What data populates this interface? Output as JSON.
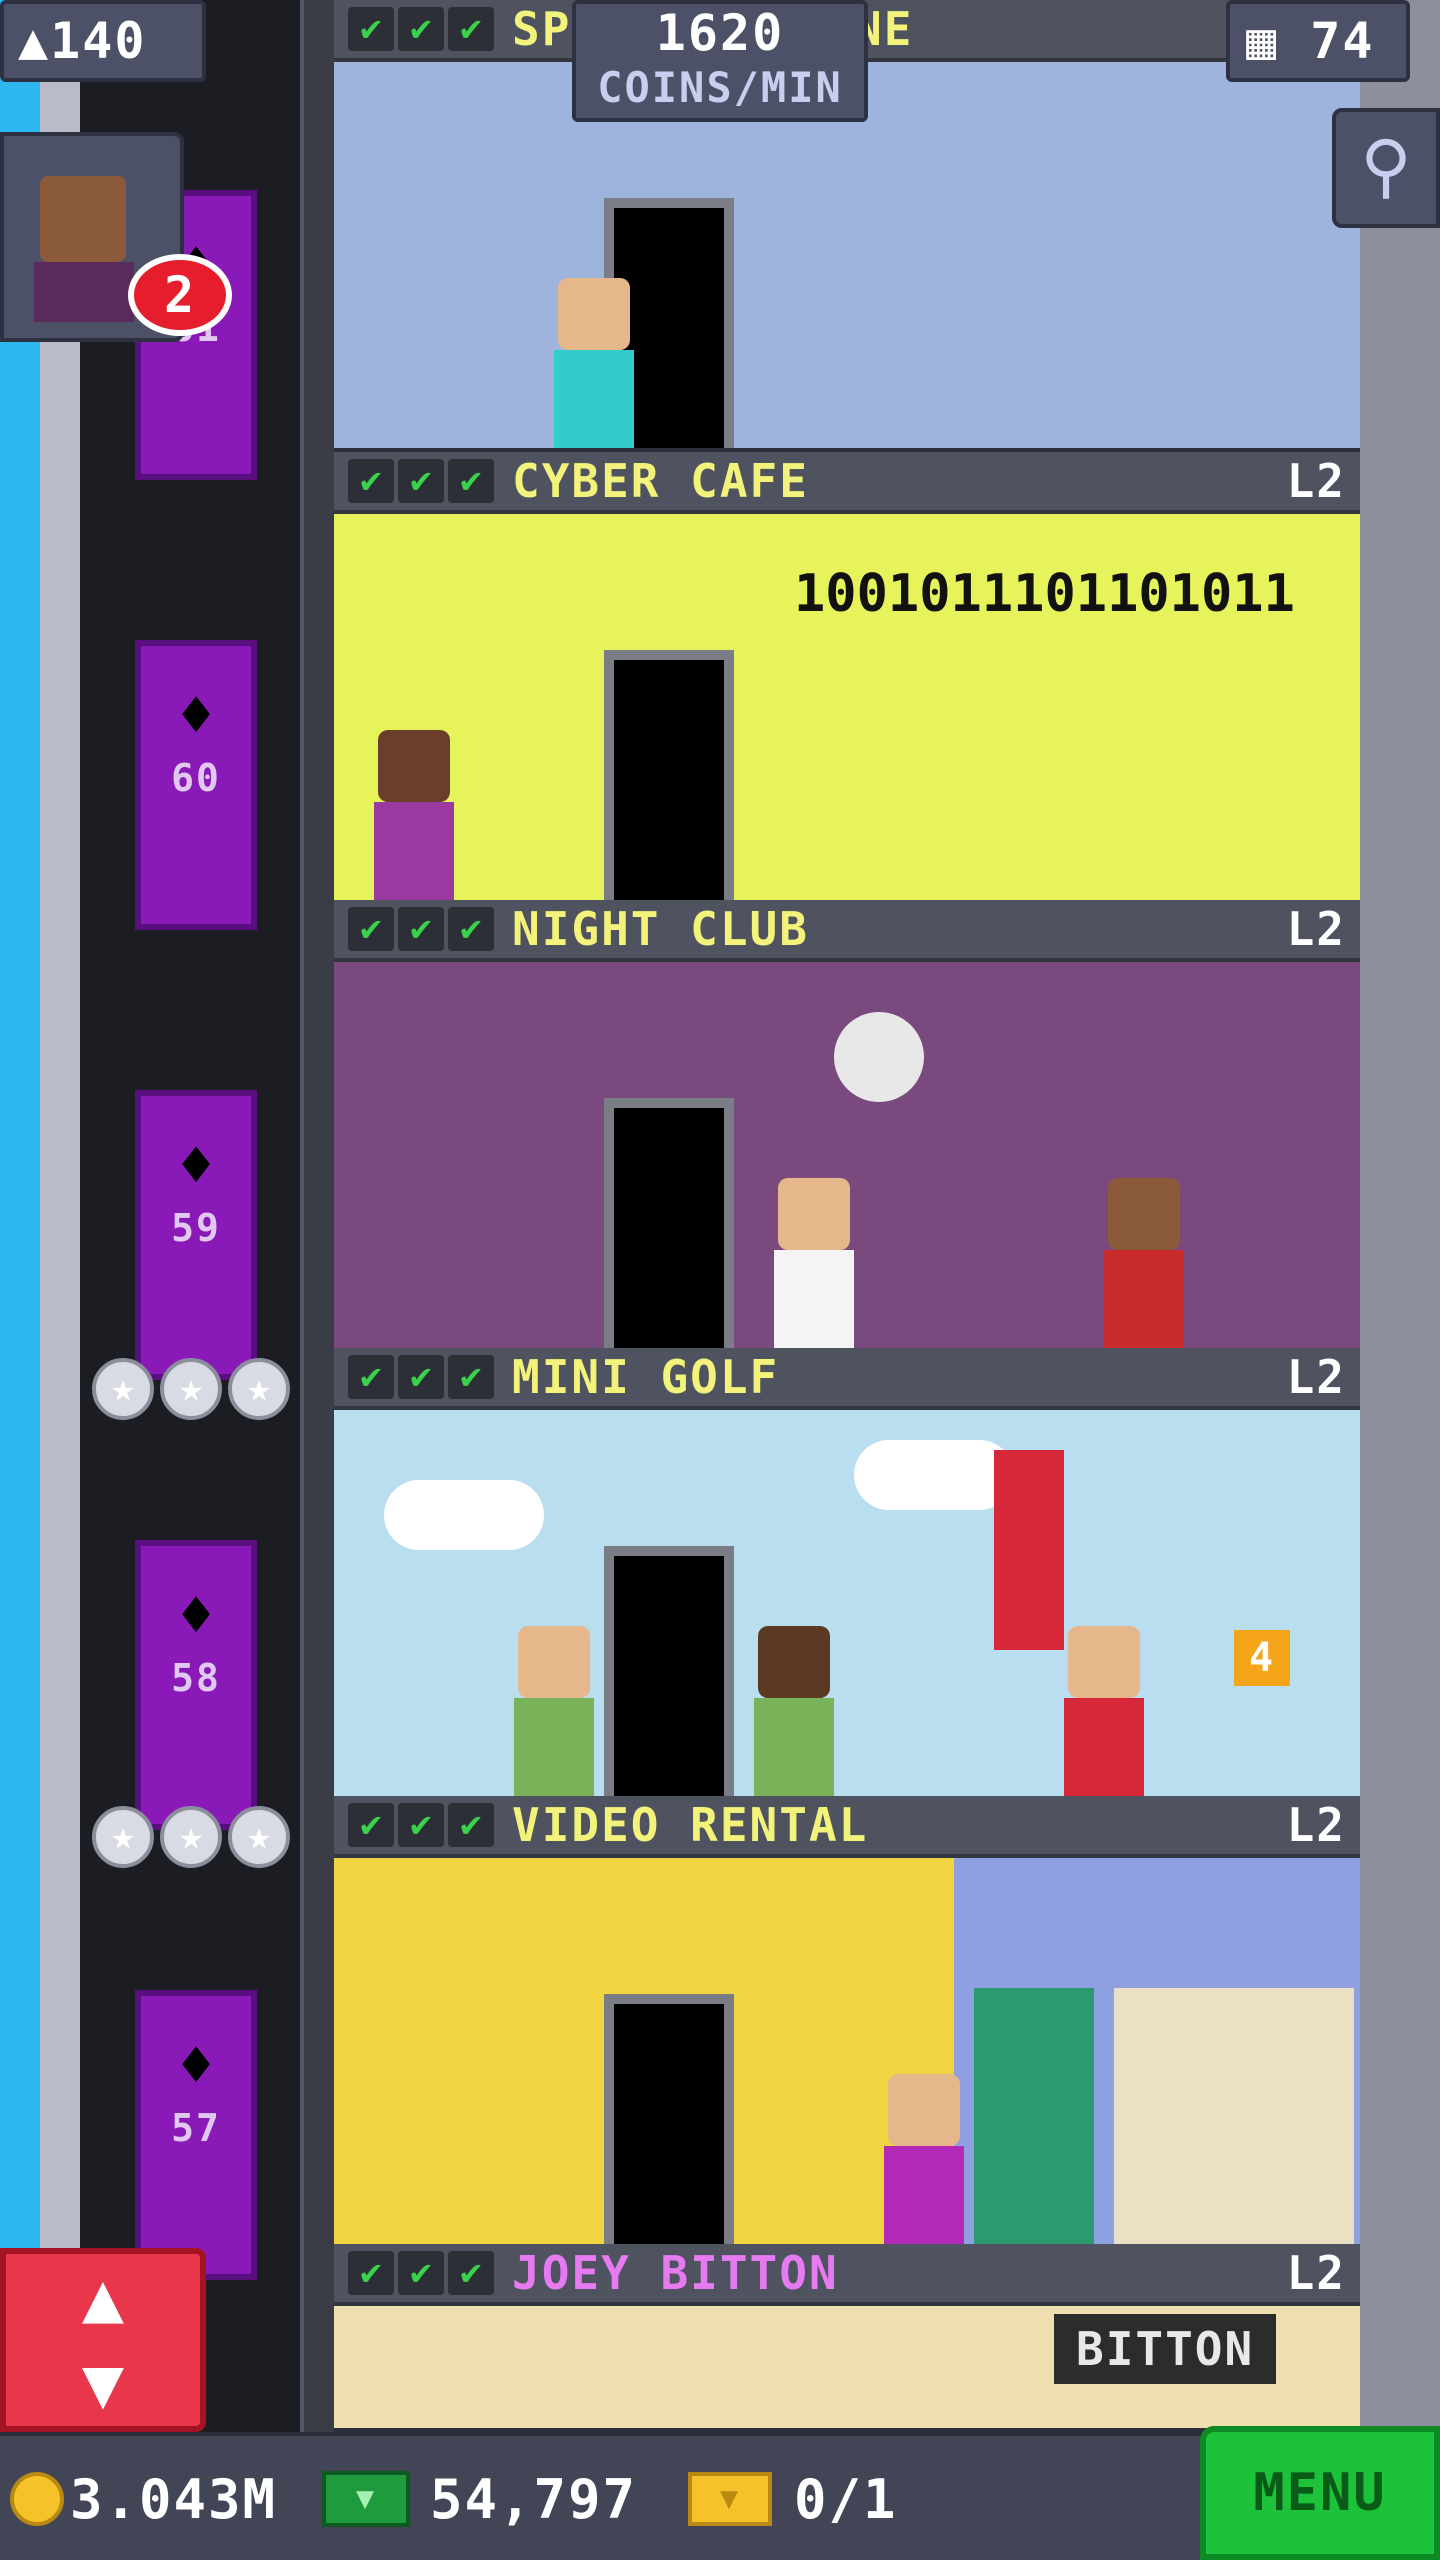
{
  "hud": {
    "population": "140",
    "coins_per_min_value": "1620",
    "coins_per_min_unit": "COINS/MIN",
    "floor_count": "74",
    "visitor_badge": "2"
  },
  "elevator": {
    "floor_labels": [
      "61",
      "60",
      "59",
      "58",
      "57"
    ]
  },
  "floors": [
    {
      "name": "SPA",
      "level": "",
      "partial_name": "SP",
      "partial_suffix": "NE",
      "room_color": "#9fb4dc"
    },
    {
      "name": "CYBER CAFE",
      "level": "L2",
      "room_text": "1001011101101011",
      "room_color": "#e6f35a"
    },
    {
      "name": "NIGHT CLUB",
      "level": "L2",
      "room_color": "#7a4a7e"
    },
    {
      "name": "MINI GOLF",
      "level": "L2",
      "room_color": "#b9def0",
      "hole_number": "4"
    },
    {
      "name": "VIDEO RENTAL",
      "level": "L2",
      "room_color": "#f1d540"
    },
    {
      "name": "JOEY BITTON",
      "level": "L2",
      "room_text": "BITTON",
      "room_color": "#f0e0b0"
    }
  ],
  "bottom_bar": {
    "coins": "3.043M",
    "bux": "54,797",
    "tickets": "0/1",
    "menu_label": "MENU"
  },
  "icons": {
    "population": "person-icon",
    "floors": "building-icon",
    "search": "magnifier-icon",
    "elevator_toggle": "up-down-arrows-icon",
    "coin": "coin-icon",
    "bux": "cash-icon",
    "ticket": "ticket-icon",
    "check": "check-icon",
    "star": "star-icon",
    "bat": "bat-icon"
  },
  "colors": {
    "floor_title": "#f3f27a",
    "joey_title": "#e67af0",
    "elevator": "#8a1ab8",
    "menu": "#1cc23a",
    "elevator_button": "#e8364b"
  }
}
